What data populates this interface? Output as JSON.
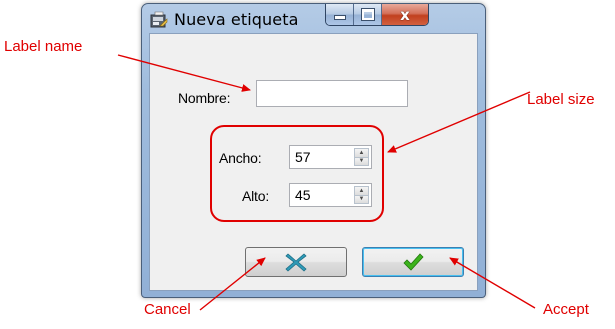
{
  "window": {
    "title": "Nueva etiqueta",
    "close_glyph": "x",
    "icons": {
      "app": "label-printer-icon",
      "minimize": "minimize-icon",
      "maximize": "maximize-icon",
      "close": "close-icon"
    }
  },
  "form": {
    "name_label": "Nombre:",
    "name_value": "",
    "width_label": "Ancho:",
    "width_value": "57",
    "height_label": "Alto:",
    "height_value": "45"
  },
  "buttons": {
    "cancel_icon": "x-cancel-icon",
    "accept_icon": "checkmark-icon"
  },
  "annotations": {
    "label_name": "Label name",
    "label_size": "Label size",
    "cancel": "Cancel",
    "accept": "Accept",
    "color": "#e00000"
  }
}
